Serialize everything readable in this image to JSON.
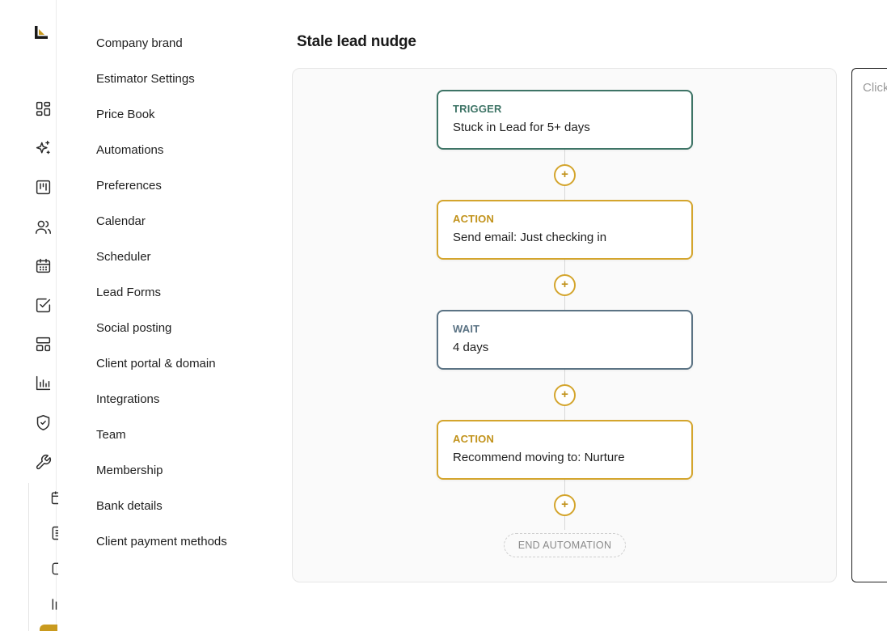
{
  "app": {
    "brand_color": "#c99a1e"
  },
  "rail": {
    "icons": [
      "dashboard-icon",
      "sparkles-icon",
      "kanban-icon",
      "users-icon",
      "calendar-icon",
      "checkbox-icon",
      "layout-icon",
      "bar-chart-icon",
      "shield-check-icon",
      "wrench-icon"
    ],
    "sub_icons": [
      "calendar-icon",
      "document-icon",
      "square-icon",
      "bar-chart-icon"
    ]
  },
  "settings_nav": {
    "items": [
      "Company brand",
      "Estimator Settings",
      "Price Book",
      "Automations",
      "Preferences",
      "Calendar",
      "Scheduler",
      "Lead Forms",
      "Social posting",
      "Client portal & domain",
      "Integrations",
      "Team",
      "Membership",
      "Bank details",
      "Client payment methods"
    ]
  },
  "automation": {
    "title": "Stale lead nudge",
    "steps": [
      {
        "kind": "TRIGGER",
        "description": "Stuck in Lead for 5+ days",
        "color": "#3e7466"
      },
      {
        "kind": "ACTION",
        "description": "Send email: Just checking in",
        "color": "#d4a52d"
      },
      {
        "kind": "WAIT",
        "description": "4 days",
        "color": "#5b7384"
      },
      {
        "kind": "ACTION",
        "description": "Recommend moving to: Nurture",
        "color": "#d4a52d"
      }
    ],
    "add_label": "+",
    "end_label": "END AUTOMATION"
  },
  "side_panel": {
    "hint": "Click"
  }
}
